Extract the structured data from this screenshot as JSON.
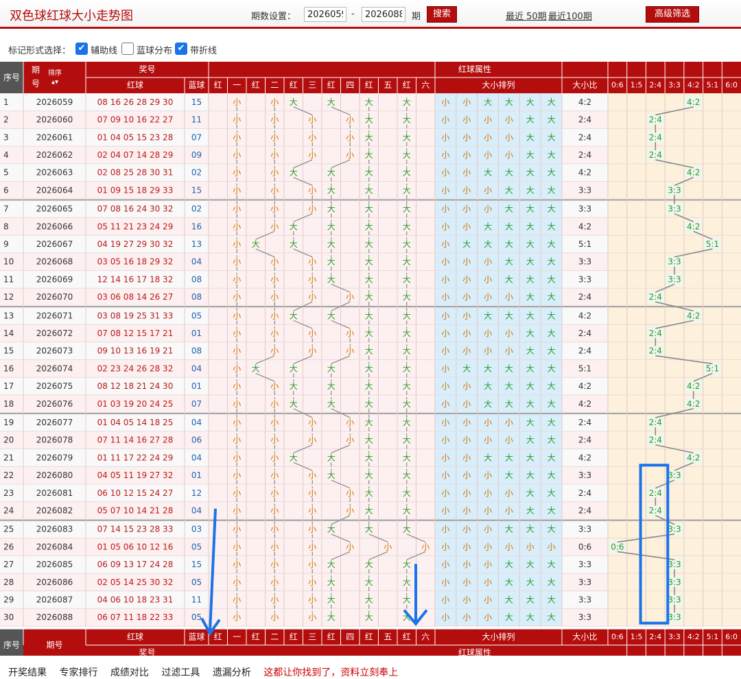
{
  "header": {
    "title": "双色球红球大小走势图",
    "period_label": "期数设置：",
    "period_start": "2026059",
    "dash": "-",
    "period_end": "2026088",
    "period_unit": "期",
    "search_label": "搜索",
    "recent50": "最近 50期",
    "recent100": "最近100期",
    "advanced_filter": "高级筛选"
  },
  "marks": {
    "label": "标记形式选择：",
    "options": [
      {
        "label": "辅助线",
        "checked": true
      },
      {
        "label": "蓝球分布",
        "checked": false
      },
      {
        "label": "带折线",
        "checked": true
      }
    ]
  },
  "table": {
    "hdr": {
      "seq": "序号",
      "qihao_a": "期",
      "qihao_b": "号",
      "sort": "排序",
      "prize": "奖号",
      "attr": "红球属性",
      "red": "红球",
      "blue": "蓝球",
      "pos": [
        "红",
        "一",
        "红",
        "二",
        "红",
        "三",
        "红",
        "四",
        "红",
        "五",
        "红",
        "六"
      ],
      "order": "大小排列",
      "ratio": "大小比",
      "ratio_cols": [
        "0:6",
        "1:5",
        "2:4",
        "3:3",
        "4:2",
        "5:1",
        "6:0"
      ],
      "qihao_full": "期号"
    },
    "rows": [
      {
        "seq": "1",
        "period": "2026059",
        "red": "08 16 26 28 29 30",
        "blue": "15",
        "sizes": "小小大大大大",
        "ratio": "4:2"
      },
      {
        "seq": "2",
        "period": "2026060",
        "red": "07 09 10 16 22 27",
        "blue": "11",
        "sizes": "小小小小大大",
        "ratio": "2:4"
      },
      {
        "seq": "3",
        "period": "2026061",
        "red": "01 04 05 15 23 28",
        "blue": "07",
        "sizes": "小小小小大大",
        "ratio": "2:4"
      },
      {
        "seq": "4",
        "period": "2026062",
        "red": "02 04 07 14 28 29",
        "blue": "09",
        "sizes": "小小小小大大",
        "ratio": "2:4"
      },
      {
        "seq": "5",
        "period": "2026063",
        "red": "02 08 25 28 30 31",
        "blue": "02",
        "sizes": "小小大大大大",
        "ratio": "4:2"
      },
      {
        "seq": "6",
        "period": "2026064",
        "red": "01 09 15 18 29 33",
        "blue": "15",
        "sizes": "小小小大大大",
        "ratio": "3:3"
      },
      {
        "seq": "7",
        "period": "2026065",
        "red": "07 08 16 24 30 32",
        "blue": "02",
        "sizes": "小小小大大大",
        "ratio": "3:3"
      },
      {
        "seq": "8",
        "period": "2026066",
        "red": "05 11 21 23 24 29",
        "blue": "16",
        "sizes": "小小大大大大",
        "ratio": "4:2"
      },
      {
        "seq": "9",
        "period": "2026067",
        "red": "04 19 27 29 30 32",
        "blue": "13",
        "sizes": "小大大大大大",
        "ratio": "5:1"
      },
      {
        "seq": "10",
        "period": "2026068",
        "red": "03 05 16 18 29 32",
        "blue": "04",
        "sizes": "小小小大大大",
        "ratio": "3:3"
      },
      {
        "seq": "11",
        "period": "2026069",
        "red": "12 14 16 17 18 32",
        "blue": "08",
        "sizes": "小小小大大大",
        "ratio": "3:3"
      },
      {
        "seq": "12",
        "period": "2026070",
        "red": "03 06 08 14 26 27",
        "blue": "08",
        "sizes": "小小小小大大",
        "ratio": "2:4"
      },
      {
        "seq": "13",
        "period": "2026071",
        "red": "03 08 19 25 31 33",
        "blue": "05",
        "sizes": "小小大大大大",
        "ratio": "4:2"
      },
      {
        "seq": "14",
        "period": "2026072",
        "red": "07 08 12 15 17 21",
        "blue": "01",
        "sizes": "小小小小大大",
        "ratio": "2:4"
      },
      {
        "seq": "15",
        "period": "2026073",
        "red": "09 10 13 16 19 21",
        "blue": "08",
        "sizes": "小小小小大大",
        "ratio": "2:4"
      },
      {
        "seq": "16",
        "period": "2026074",
        "red": "02 23 24 26 28 32",
        "blue": "04",
        "sizes": "小大大大大大",
        "ratio": "5:1"
      },
      {
        "seq": "17",
        "period": "2026075",
        "red": "08 12 18 21 24 30",
        "blue": "01",
        "sizes": "小小大大大大",
        "ratio": "4:2"
      },
      {
        "seq": "18",
        "period": "2026076",
        "red": "01 03 19 20 24 25",
        "blue": "07",
        "sizes": "小小大大大大",
        "ratio": "4:2"
      },
      {
        "seq": "19",
        "period": "2026077",
        "red": "01 04 05 14 18 25",
        "blue": "04",
        "sizes": "小小小小大大",
        "ratio": "2:4"
      },
      {
        "seq": "20",
        "period": "2026078",
        "red": "07 11 14 16 27 28",
        "blue": "06",
        "sizes": "小小小小大大",
        "ratio": "2:4"
      },
      {
        "seq": "21",
        "period": "2026079",
        "red": "01 11 17 22 24 29",
        "blue": "04",
        "sizes": "小小大大大大",
        "ratio": "4:2"
      },
      {
        "seq": "22",
        "period": "2026080",
        "red": "04 05 11 19 27 32",
        "blue": "01",
        "sizes": "小小小大大大",
        "ratio": "3:3"
      },
      {
        "seq": "23",
        "period": "2026081",
        "red": "06 10 12 15 24 27",
        "blue": "12",
        "sizes": "小小小小大大",
        "ratio": "2:4"
      },
      {
        "seq": "24",
        "period": "2026082",
        "red": "05 07 10 14 21 28",
        "blue": "04",
        "sizes": "小小小小大大",
        "ratio": "2:4"
      },
      {
        "seq": "25",
        "period": "2026083",
        "red": "07 14 15 23 28 33",
        "blue": "03",
        "sizes": "小小小大大大",
        "ratio": "3:3"
      },
      {
        "seq": "26",
        "period": "2026084",
        "red": "01 05 06 10 12 16",
        "blue": "05",
        "sizes": "小小小小小小",
        "ratio": "0:6"
      },
      {
        "seq": "27",
        "period": "2026085",
        "red": "06 09 13 17 24 28",
        "blue": "15",
        "sizes": "小小小大大大",
        "ratio": "3:3"
      },
      {
        "seq": "28",
        "period": "2026086",
        "red": "02 05 14 25 30 32",
        "blue": "05",
        "sizes": "小小小大大大",
        "ratio": "3:3"
      },
      {
        "seq": "29",
        "period": "2026087",
        "red": "04 06 10 18 23 31",
        "blue": "11",
        "sizes": "小小小大大大",
        "ratio": "3:3"
      },
      {
        "seq": "30",
        "period": "2026088",
        "red": "06 07 11 18 22 33",
        "blue": "05",
        "sizes": "小小小大大大",
        "ratio": "3:3"
      }
    ]
  },
  "bottom": {
    "links": [
      "开奖结果",
      "专家排行",
      "成绩对比",
      "过滤工具",
      "遗漏分析"
    ],
    "promo": "这都让你找到了，资料立刻奉上"
  },
  "colors": {
    "header_red": "#b40d0d",
    "small": "#d07000",
    "big": "#2a9a2a",
    "blue_num": "#1f5fb0",
    "red_num": "#c01818",
    "annotation": "#1a73e8"
  },
  "icons": {
    "sort": "sort-arrows-icon",
    "check": "checkmark-icon",
    "annotation": "annotation-arrow-icon"
  }
}
